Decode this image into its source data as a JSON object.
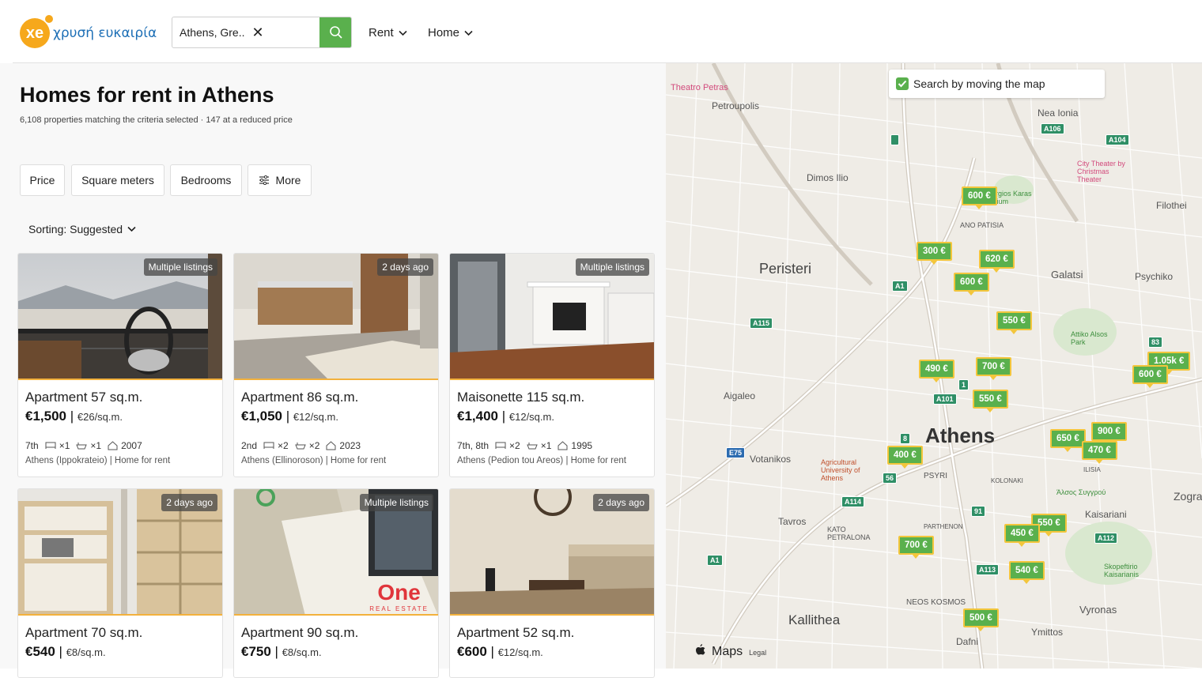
{
  "header": {
    "logo_badge": "xe",
    "logo_text": "χρυσή ευκαιρία",
    "search_value": "Athens, Gre...",
    "nav": [
      {
        "label": "Rent"
      },
      {
        "label": "Home"
      }
    ]
  },
  "main": {
    "title": "Homes for rent in Athens",
    "subtitle": "6,108 properties matching the criteria selected · 147 at a reduced price",
    "filters": [
      "Price",
      "Square meters",
      "Bedrooms",
      "More"
    ],
    "sorting": "Sorting: Suggested"
  },
  "listings": [
    {
      "badge": "Multiple listings",
      "title": "Apartment 57 sq.m.",
      "price": "€1,500",
      "ppsqm": "€26/sq.m.",
      "floor": "7th",
      "beds": "×1",
      "baths": "×1",
      "year": "2007",
      "location": "Athens (Ippokrateio) | Home for rent"
    },
    {
      "badge": "2 days ago",
      "title": "Apartment 86 sq.m.",
      "price": "€1,050",
      "ppsqm": "€12/sq.m.",
      "floor": "2nd",
      "beds": "×2",
      "baths": "×2",
      "year": "2023",
      "location": "Athens (Ellinoroson) | Home for rent"
    },
    {
      "badge": "Multiple listings",
      "title": "Maisonette 115 sq.m.",
      "price": "€1,400",
      "ppsqm": "€12/sq.m.",
      "floor": "7th, 8th",
      "beds": "×2",
      "baths": "×1",
      "year": "1995",
      "location": "Athens (Pedion tou Areos) | Home for rent"
    },
    {
      "badge": "2 days ago",
      "title": "Apartment 70 sq.m.",
      "price": "€540",
      "ppsqm": "€8/sq.m."
    },
    {
      "badge": "Multiple listings",
      "title": "Apartment 90 sq.m.",
      "price": "€750",
      "ppsqm": "€8/sq.m.",
      "watermark": "One",
      "watermark_sub": "REAL ESTATE"
    },
    {
      "badge": "2 days ago",
      "title": "Apartment 52 sq.m.",
      "price": "€600",
      "ppsqm": "€12/sq.m."
    }
  ],
  "map": {
    "search_toggle": "Search by moving the map",
    "search_toggle_checked": true,
    "attribution": "Maps",
    "legal": "Legal",
    "labels": {
      "athens": "Athens",
      "peristeri": "Peristeri",
      "kallithea": "Kallithea",
      "galatsi": "Galatsi",
      "zografou": "Zografo",
      "petroupolis": "Petroupolis",
      "nea_ionia": "Nea Ionia",
      "dimos_ilio": "Dimos Ilio",
      "filothei": "Filothei",
      "psychiko": "Psychiko",
      "aigaleo": "Aigaleo",
      "votanikos": "Votanikos",
      "tavros": "Tavros",
      "vyronas": "Vyronas",
      "ymittos": "Ymittos",
      "dafni": "Dafni",
      "ano_patisia": "ANO PATISIA",
      "psyri": "PSYRI",
      "kolonaki": "KOLONAKI",
      "neos_kosmos": "NEOS KOSMOS",
      "kato_petralona": "KATO PETRALONA",
      "parthenon": "PARTHENON",
      "ilisia": "ILISIA",
      "theatro_petras": "Theatro Petras",
      "city_theater": "City Theater by Christmas Theater",
      "stadium": "Georgios Karas Stadium",
      "attiko": "Attiko Alsos Park",
      "skopeftirio": "Skopeftirio Kaisarianis",
      "agricultural": "Agricultural University of Athens",
      "alsos": "Άλσος Συγγρού",
      "kaisariani": "Kaisariani"
    },
    "pins": [
      "600 €",
      "300 €",
      "620 €",
      "600 €",
      "550 €",
      "490 €",
      "700 €",
      "550 €",
      "400 €",
      "650 €",
      "900 €",
      "470 €",
      "1.05k €",
      "600 €",
      "550 €",
      "450 €",
      "540 €",
      "700 €",
      "500 €"
    ],
    "colors": {
      "pin": "#5ab04d",
      "pin_border": "#f3c63c",
      "accent": "#5ab04d"
    }
  }
}
